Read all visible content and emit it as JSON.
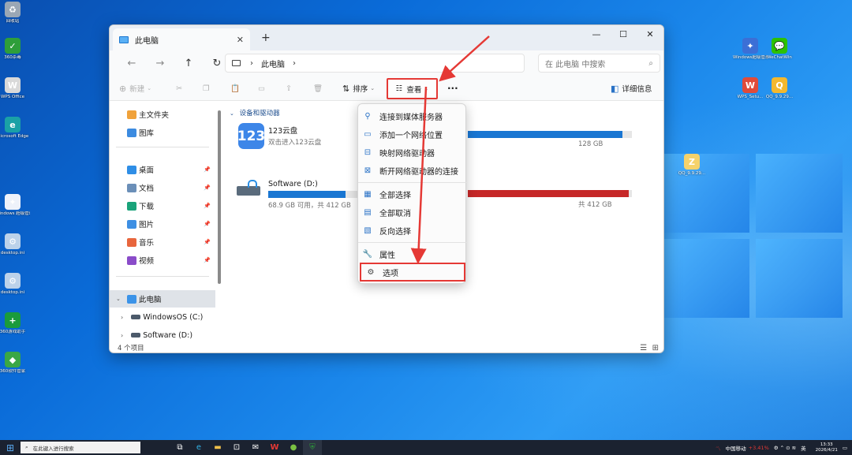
{
  "desktop": {
    "left_icons": [
      {
        "name": "recycle-bin-icon",
        "label": "回收站",
        "color": "#9aa7b5",
        "glyph": "♻"
      },
      {
        "name": "360-security-icon",
        "label": "360杀毒",
        "color": "#2e9e3a",
        "glyph": "✓"
      },
      {
        "name": "wps-office-icon",
        "label": "WPS Office",
        "color": "#d9d9d9",
        "glyph": "W"
      },
      {
        "name": "edge-icon",
        "label": "Microsoft Edge",
        "color": "#1aa1a6",
        "glyph": "e"
      },
      {
        "name": "windows-tool-icon",
        "label": "Windows 超级管理器",
        "color": "#eef2fa",
        "glyph": "✦"
      },
      {
        "name": "desktop-ini-icon-1",
        "label": "desktop.ini",
        "color": "#bcd2ea",
        "glyph": "⚙"
      },
      {
        "name": "desktop-ini-icon-2",
        "label": "desktop.ini",
        "color": "#bcd2ea",
        "glyph": "⚙"
      },
      {
        "name": "game-assistant-icon",
        "label": "360游戏助手",
        "color": "#1a9b3c",
        "glyph": "+"
      },
      {
        "name": "software-manager-icon",
        "label": "360软件管家",
        "color": "#3aa745",
        "glyph": "◆"
      }
    ],
    "right_icons": [
      {
        "name": "windows-manager-icon",
        "label": "Windows超级管理器",
        "color": "#3b6fd6",
        "glyph": "✦"
      },
      {
        "name": "wechat-icon",
        "label": "WeChatWin",
        "color": "#2dc100",
        "glyph": "💬"
      },
      {
        "name": "wps-setup-icon",
        "label": "WPS_Setu...",
        "color": "#e04b3a",
        "glyph": "W"
      },
      {
        "name": "qq-icon",
        "label": "QQ_9.9.29...",
        "color": "#f3b82f",
        "glyph": "Q"
      },
      {
        "name": "zip-file-icon",
        "label": "QQ_9.9.29...",
        "color": "#f5d26b",
        "glyph": "Z"
      }
    ]
  },
  "window": {
    "tab_title": "此电脑",
    "controls": {
      "minimize": "—",
      "maximize": "☐",
      "close": "✕"
    },
    "breadcrumb": [
      "此电脑"
    ],
    "search_placeholder": "在 此电脑 中搜索",
    "toolbar": {
      "new_label": "新建",
      "sort_label": "排序",
      "view_label": "查看",
      "more_label": "···",
      "details_label": "详细信息"
    },
    "sidebar": {
      "home": "主文件夹",
      "gallery": "图库",
      "pinned": [
        "桌面",
        "文档",
        "下载",
        "图片",
        "音乐",
        "视频"
      ],
      "this_pc": "此电脑",
      "drives": [
        "WindowsOS (C:)",
        "Software (D:)"
      ]
    },
    "content": {
      "group_header": "设备和驱动器",
      "drives": [
        {
          "name": "123云盘",
          "sub": "双击进入123云盘",
          "size_text": "128 GB",
          "used_fraction": 0.94,
          "color": "#1976d2"
        },
        {
          "name": "Software (D:)",
          "sub": "68.9 GB 可用，共 412 GB",
          "size_text": "共 412 GB",
          "used_fraction": 0.83,
          "color": "#1976d2"
        },
        {
          "name": "",
          "sub": "共 412 GB",
          "used_fraction": 0.98,
          "color": "#c62828"
        }
      ]
    },
    "status": "4 个项目"
  },
  "view_menu": {
    "items": [
      {
        "label": "连接到媒体服务器",
        "icon": "media-server-icon",
        "glyph": "⚲"
      },
      {
        "label": "添加一个网络位置",
        "icon": "network-location-icon",
        "glyph": "▭"
      },
      {
        "label": "映射网络驱动器",
        "icon": "map-drive-icon",
        "glyph": "⊟"
      },
      {
        "label": "断开网络驱动器的连接",
        "icon": "disconnect-drive-icon",
        "glyph": "⊠"
      },
      {
        "label": "全部选择",
        "icon": "select-all-icon",
        "glyph": "▦"
      },
      {
        "label": "全部取消",
        "icon": "select-none-icon",
        "glyph": "▤"
      },
      {
        "label": "反向选择",
        "icon": "invert-selection-icon",
        "glyph": "▧"
      },
      {
        "label": "属性",
        "icon": "wrench-icon",
        "glyph": "🔧"
      },
      {
        "label": "选项",
        "icon": "gear-icon",
        "glyph": "⚙"
      }
    ]
  },
  "taskbar": {
    "search_placeholder": "在此键入进行搜索",
    "tray": {
      "stock": "中国移动",
      "stock_change": "+3.41%",
      "ime": "英",
      "time": "13:33",
      "date": "2026/4/21"
    }
  },
  "annotation_color": "#e53935"
}
